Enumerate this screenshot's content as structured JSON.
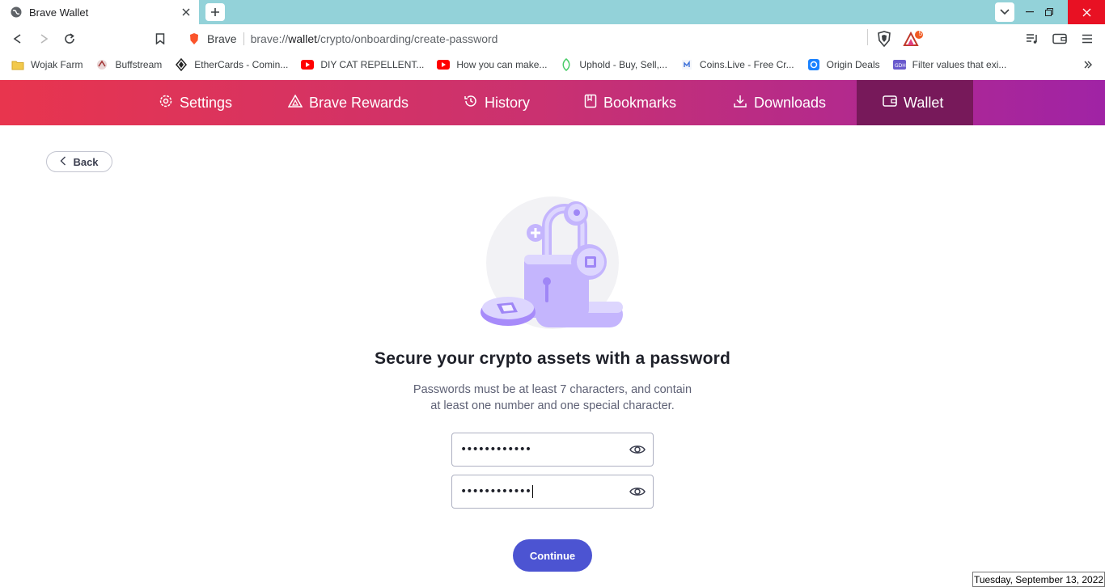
{
  "tab": {
    "title": "Brave Wallet"
  },
  "toolbar": {
    "site_label": "Brave",
    "url_prefix": "brave://",
    "url_host": "wallet",
    "url_path": "/crypto/onboarding/create-password",
    "rewards_badge": "5"
  },
  "bookmarks": [
    {
      "label": "Wojak Farm",
      "icon": "folder-icon"
    },
    {
      "label": "Buffstream",
      "icon": "buffstream-icon"
    },
    {
      "label": "EtherCards - Comin...",
      "icon": "ethercards-icon"
    },
    {
      "label": "DIY CAT REPELLENT...",
      "icon": "youtube-icon"
    },
    {
      "label": "How you can make...",
      "icon": "youtube-icon"
    },
    {
      "label": "Uphold - Buy, Sell,...",
      "icon": "uphold-icon"
    },
    {
      "label": "Coins.Live - Free Cr...",
      "icon": "coinslive-icon"
    },
    {
      "label": "Origin Deals",
      "icon": "origin-icon"
    },
    {
      "label": "Filter values that exi...",
      "icon": "site-icon"
    }
  ],
  "nav": {
    "settings": "Settings",
    "rewards": "Brave Rewards",
    "history": "History",
    "bookmarks": "Bookmarks",
    "downloads": "Downloads",
    "wallet": "Wallet"
  },
  "content": {
    "back_label": "Back",
    "heading": "Secure your crypto assets with a password",
    "desc_line1": "Passwords must be at least 7 characters, and contain",
    "desc_line2": "at least one number and one special character.",
    "password_value": "••••••••••••",
    "confirm_value": "••••••••••••",
    "continue_label": "Continue"
  },
  "taskbar": {
    "date": "Tuesday, September 13, 2022"
  },
  "colors": {
    "nav_start": "#e8354e",
    "nav_end": "#a023a5",
    "nav_active": "#77195a",
    "primary_button": "#4c54d2",
    "tabstrip": "#93d2d9"
  }
}
